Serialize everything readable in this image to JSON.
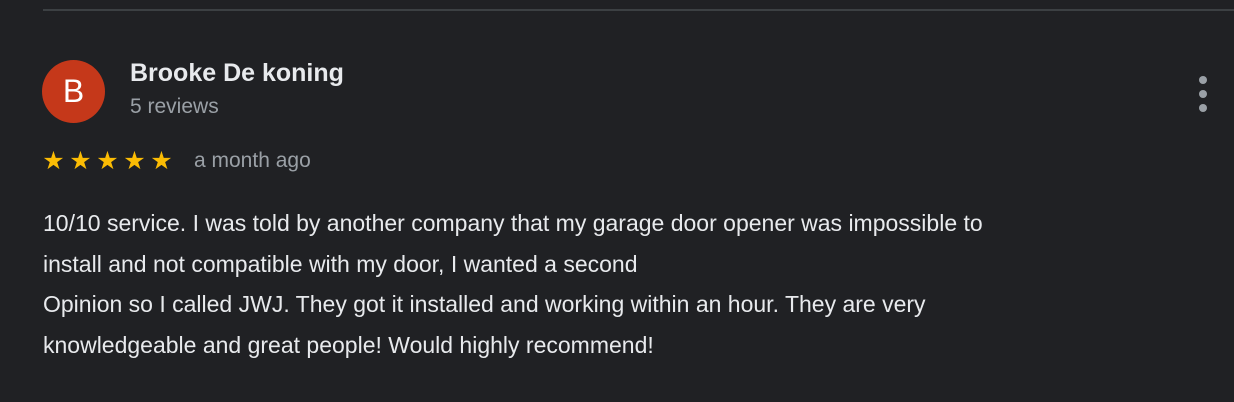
{
  "review": {
    "author": {
      "initial": "B",
      "name": "Brooke De koning",
      "reviews_count": "5 reviews",
      "avatar_color": "#c5381a"
    },
    "rating": {
      "value": 5,
      "max": 5,
      "star_color": "#fbbc04",
      "icon": "star-icon"
    },
    "date": "a month ago",
    "menu_icon": "more-vert-icon",
    "text_lines": [
      "10/10 service. I was told by another company that my garage door opener was impossible to",
      "install and not compatible with my door, I wanted a second",
      "Opinion so I called JWJ. They got it installed and working within an hour. They are very",
      "knowledgeable and great people! Would highly recommend!"
    ]
  }
}
